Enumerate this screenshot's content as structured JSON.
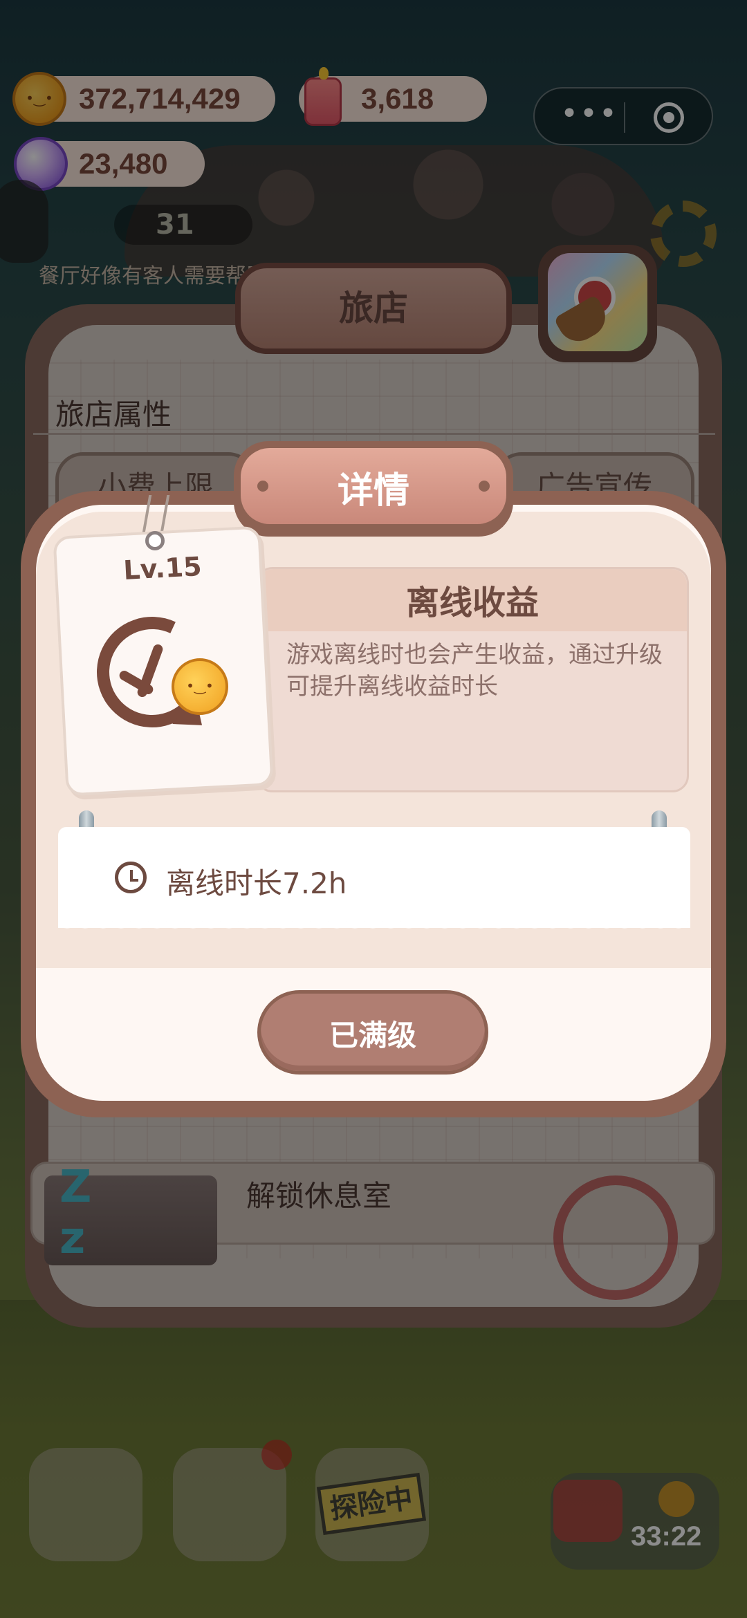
{
  "resources": {
    "coins": "372,714,429",
    "candles": "3,618",
    "gems": "23,480"
  },
  "background": {
    "hint_text": "餐厅好像有客人需要帮助",
    "counter": "31",
    "main_title": "旅店",
    "section_title": "旅店属性",
    "tab_left": "小费上限",
    "tab_right": "广告宣传",
    "row_label": "解锁休息室",
    "adventure_badge": "探险中",
    "timer": "33:22"
  },
  "modal": {
    "title": "详情",
    "level": "Lv.15",
    "skill_name": "离线收益",
    "skill_desc": "游戏离线时也会产生收益，通过升级可提升离线收益时长",
    "stat_text": "离线时长7.2h",
    "max_button": "已满级"
  },
  "colors": {
    "modal_frame": "#8d6253",
    "sign": "#c9887a",
    "text_brown": "#6d4a40"
  }
}
